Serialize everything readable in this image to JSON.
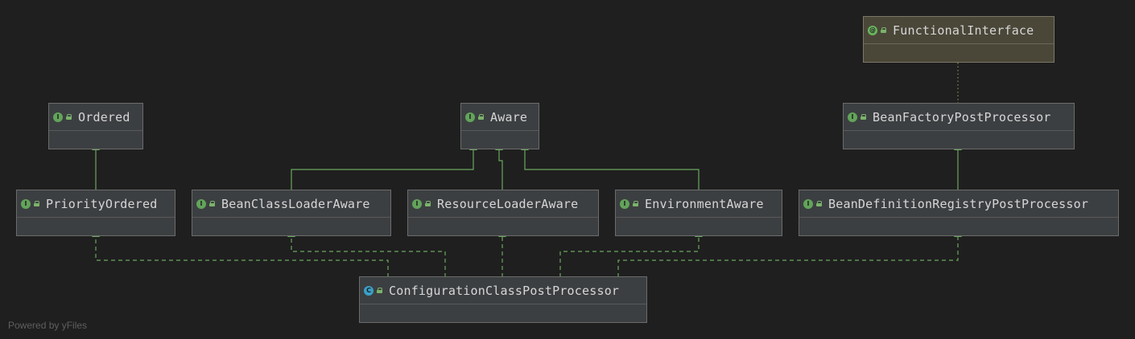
{
  "diagram": {
    "nodes": [
      {
        "id": "functional_interface",
        "name": "FunctionalInterface",
        "kind": "annotation"
      },
      {
        "id": "ordered",
        "name": "Ordered",
        "kind": "interface"
      },
      {
        "id": "aware",
        "name": "Aware",
        "kind": "interface"
      },
      {
        "id": "bean_factory_post_processor",
        "name": "BeanFactoryPostProcessor",
        "kind": "interface"
      },
      {
        "id": "priority_ordered",
        "name": "PriorityOrdered",
        "kind": "interface"
      },
      {
        "id": "bean_class_loader_aware",
        "name": "BeanClassLoaderAware",
        "kind": "interface"
      },
      {
        "id": "resource_loader_aware",
        "name": "ResourceLoaderAware",
        "kind": "interface"
      },
      {
        "id": "environment_aware",
        "name": "EnvironmentAware",
        "kind": "interface"
      },
      {
        "id": "bean_definition_registry_post_processor",
        "name": "BeanDefinitionRegistryPostProcessor",
        "kind": "interface"
      },
      {
        "id": "configuration_class_post_processor",
        "name": "ConfigurationClassPostProcessor",
        "kind": "class"
      }
    ],
    "edges": [
      {
        "from": "priority_ordered",
        "to": "ordered",
        "style": "extends"
      },
      {
        "from": "bean_class_loader_aware",
        "to": "aware",
        "style": "extends"
      },
      {
        "from": "resource_loader_aware",
        "to": "aware",
        "style": "extends"
      },
      {
        "from": "environment_aware",
        "to": "aware",
        "style": "extends"
      },
      {
        "from": "bean_definition_registry_post_processor",
        "to": "bean_factory_post_processor",
        "style": "extends"
      },
      {
        "from": "bean_factory_post_processor",
        "to": "functional_interface",
        "style": "annotated"
      },
      {
        "from": "configuration_class_post_processor",
        "to": "priority_ordered",
        "style": "implements"
      },
      {
        "from": "configuration_class_post_processor",
        "to": "bean_class_loader_aware",
        "style": "implements"
      },
      {
        "from": "configuration_class_post_processor",
        "to": "resource_loader_aware",
        "style": "implements"
      },
      {
        "from": "configuration_class_post_processor",
        "to": "environment_aware",
        "style": "implements"
      },
      {
        "from": "configuration_class_post_processor",
        "to": "bean_definition_registry_post_processor",
        "style": "implements"
      }
    ],
    "colors": {
      "background": "#1f1f1f",
      "node_fill": "#3c3f41",
      "annotation_fill": "#4a4739",
      "edge": "#6aa85f",
      "interface_badge": "#62a45a",
      "class_badge": "#3aa0c7"
    },
    "badge_letters": {
      "interface": "I",
      "class": "C",
      "annotation": "@"
    }
  },
  "footer": {
    "credit": "Powered by yFiles"
  }
}
